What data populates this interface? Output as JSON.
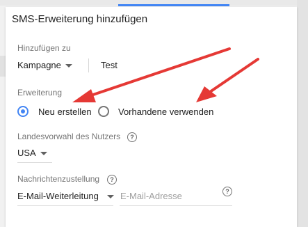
{
  "dialog": {
    "title": "SMS-Erweiterung hinzufügen"
  },
  "add_to": {
    "label": "Hinzufügen zu",
    "level_value": "Kampagne",
    "campaign_value": "Test"
  },
  "extension": {
    "label": "Erweiterung",
    "options": [
      {
        "label": "Neu erstellen",
        "selected": true
      },
      {
        "label": "Vorhandene verwenden",
        "selected": false
      }
    ]
  },
  "country": {
    "label": "Landesvorwahl des Nutzers",
    "value": "USA",
    "help_icon": "question-circle-icon"
  },
  "delivery": {
    "label": "Nachrichtenzustellung",
    "method_value": "E-Mail-Weiterleitung",
    "email_placeholder": "E-Mail-Adresse",
    "help_icon": "question-circle-icon"
  },
  "colors": {
    "accent": "#4285f4",
    "annotation_arrow": "#e53935"
  }
}
